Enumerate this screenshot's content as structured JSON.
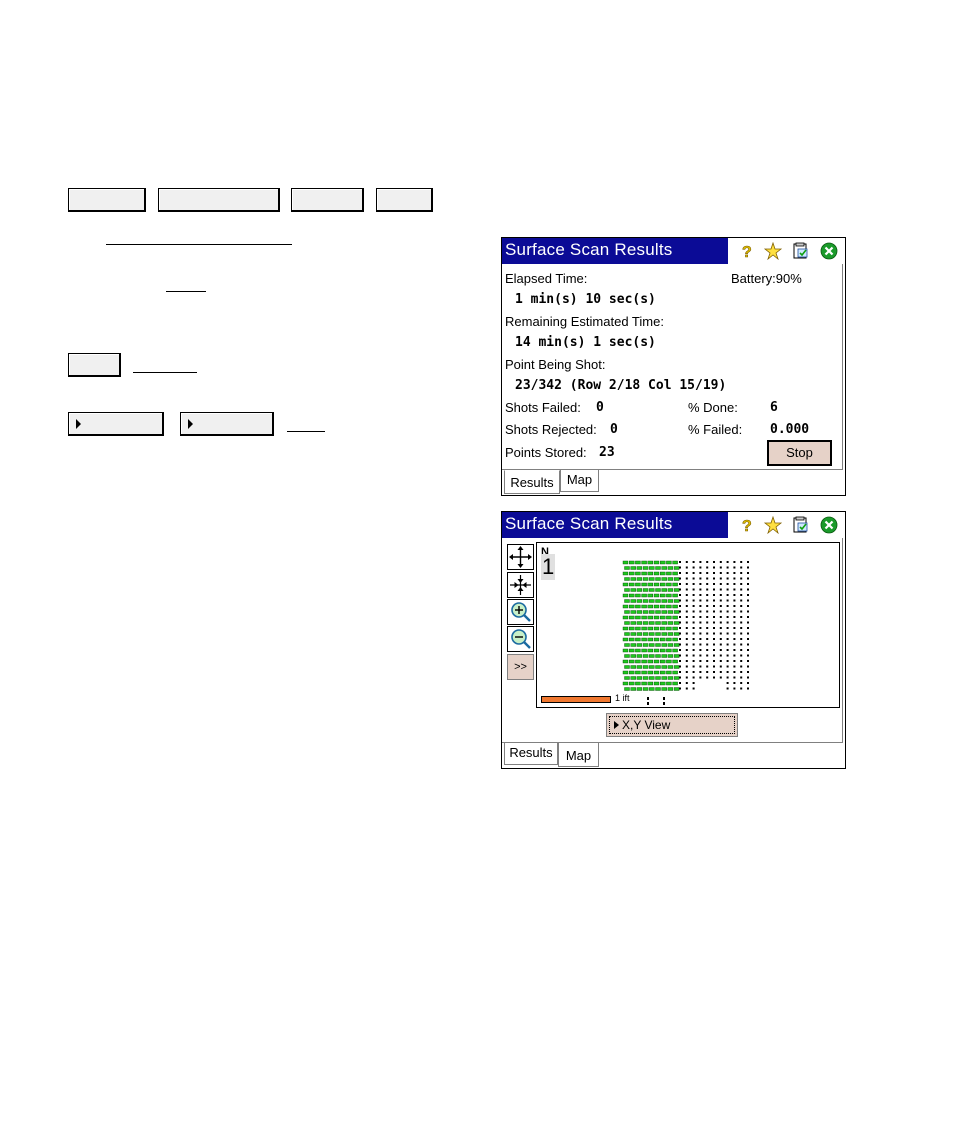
{
  "screen1": {
    "title": "Surface Scan Results",
    "elapsed_label": "Elapsed Time:",
    "elapsed_value": "1 min(s) 10 sec(s)",
    "battery_label": "Battery:90%",
    "remaining_label": "Remaining Estimated Time:",
    "remaining_value": "14 min(s) 1 sec(s)",
    "point_label": "Point Being Shot:",
    "point_value": "23/342 (Row 2/18  Col 15/19)",
    "shots_failed_label": "Shots Failed:",
    "shots_failed_value": "0",
    "done_label": "% Done:",
    "done_value": "6",
    "shots_rejected_label": "Shots Rejected:",
    "shots_rejected_value": "0",
    "failed_label": "% Failed:",
    "failed_value": "0.000",
    "points_stored_label": "Points Stored:",
    "points_stored_value": "23",
    "stop_label": "Stop",
    "tab_results": "Results",
    "tab_map": "Map"
  },
  "screen2": {
    "title": "Surface Scan Results",
    "north_label": "N",
    "north_digit": "1",
    "scale_label": "1 ift",
    "more_label": ">>",
    "xy_view_label": "X,Y View",
    "tab_results": "Results",
    "tab_map": "Map"
  },
  "icons": {
    "help": "help-icon",
    "favorite": "star-icon",
    "checklist": "checklist-icon",
    "close": "close-icon"
  },
  "colors": {
    "titlebar": "#0b0b96",
    "stop_button": "#e6d2c8",
    "scanned_point": "#1ec81e",
    "scale_bar": "#f07830"
  }
}
